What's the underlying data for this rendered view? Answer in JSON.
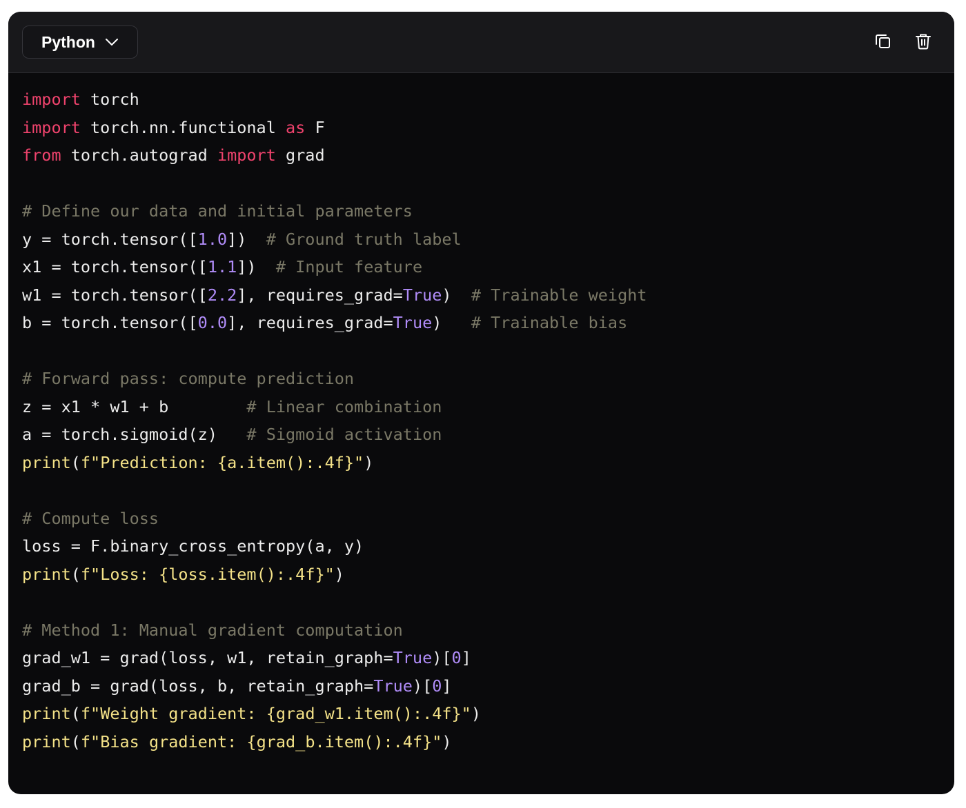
{
  "toolbar": {
    "language": "Python",
    "icons": {
      "chevron": "chevron-down-icon",
      "copy": "copy-icon",
      "delete": "trash-icon"
    }
  },
  "colors": {
    "background": "#0a0a0c",
    "toolbar": "#18181b",
    "keyword": "#f0436d",
    "number": "#b08cf8",
    "comment": "#7a7866",
    "string": "#f4e288",
    "text": "#ececec"
  },
  "code": {
    "lines": [
      [
        [
          "kw",
          "import"
        ],
        [
          "pl",
          " torch"
        ]
      ],
      [
        [
          "kw",
          "import"
        ],
        [
          "pl",
          " torch.nn.functional "
        ],
        [
          "kw",
          "as"
        ],
        [
          "pl",
          " F"
        ]
      ],
      [
        [
          "kw",
          "from"
        ],
        [
          "pl",
          " torch.autograd "
        ],
        [
          "kw",
          "import"
        ],
        [
          "pl",
          " grad"
        ]
      ],
      [],
      [
        [
          "cm",
          "# Define our data and initial parameters"
        ]
      ],
      [
        [
          "pl",
          "y = torch.tensor(["
        ],
        [
          "num",
          "1.0"
        ],
        [
          "pl",
          "])  "
        ],
        [
          "cm",
          "# Ground truth label"
        ]
      ],
      [
        [
          "pl",
          "x1 = torch.tensor(["
        ],
        [
          "num",
          "1.1"
        ],
        [
          "pl",
          "])  "
        ],
        [
          "cm",
          "# Input feature"
        ]
      ],
      [
        [
          "pl",
          "w1 = torch.tensor(["
        ],
        [
          "num",
          "2.2"
        ],
        [
          "pl",
          "], requires_grad="
        ],
        [
          "num",
          "True"
        ],
        [
          "pl",
          ")  "
        ],
        [
          "cm",
          "# Trainable weight"
        ]
      ],
      [
        [
          "pl",
          "b = torch.tensor(["
        ],
        [
          "num",
          "0.0"
        ],
        [
          "pl",
          "], requires_grad="
        ],
        [
          "num",
          "True"
        ],
        [
          "pl",
          ")   "
        ],
        [
          "cm",
          "# Trainable bias"
        ]
      ],
      [],
      [
        [
          "cm",
          "# Forward pass: compute prediction"
        ]
      ],
      [
        [
          "pl",
          "z = x1 * w1 + b        "
        ],
        [
          "cm",
          "# Linear combination"
        ]
      ],
      [
        [
          "pl",
          "a = torch.sigmoid(z)   "
        ],
        [
          "cm",
          "# Sigmoid activation"
        ]
      ],
      [
        [
          "str",
          "print"
        ],
        [
          "pl",
          "("
        ],
        [
          "str",
          "f\"Prediction: {a.item():.4f}\""
        ],
        [
          "pl",
          ")"
        ]
      ],
      [],
      [
        [
          "cm",
          "# Compute loss"
        ]
      ],
      [
        [
          "pl",
          "loss = F.binary_cross_entropy(a, y)"
        ]
      ],
      [
        [
          "str",
          "print"
        ],
        [
          "pl",
          "("
        ],
        [
          "str",
          "f\"Loss: {loss.item():.4f}\""
        ],
        [
          "pl",
          ")"
        ]
      ],
      [],
      [
        [
          "cm",
          "# Method 1: Manual gradient computation"
        ]
      ],
      [
        [
          "pl",
          "grad_w1 = grad(loss, w1, retain_graph="
        ],
        [
          "num",
          "True"
        ],
        [
          "pl",
          ")["
        ],
        [
          "num",
          "0"
        ],
        [
          "pl",
          "]"
        ]
      ],
      [
        [
          "pl",
          "grad_b = grad(loss, b, retain_graph="
        ],
        [
          "num",
          "True"
        ],
        [
          "pl",
          ")["
        ],
        [
          "num",
          "0"
        ],
        [
          "pl",
          "]"
        ]
      ],
      [
        [
          "str",
          "print"
        ],
        [
          "pl",
          "("
        ],
        [
          "str",
          "f\"Weight gradient: {grad_w1.item():.4f}\""
        ],
        [
          "pl",
          ")"
        ]
      ],
      [
        [
          "str",
          "print"
        ],
        [
          "pl",
          "("
        ],
        [
          "str",
          "f\"Bias gradient: {grad_b.item():.4f}\""
        ],
        [
          "pl",
          ")"
        ]
      ]
    ]
  }
}
